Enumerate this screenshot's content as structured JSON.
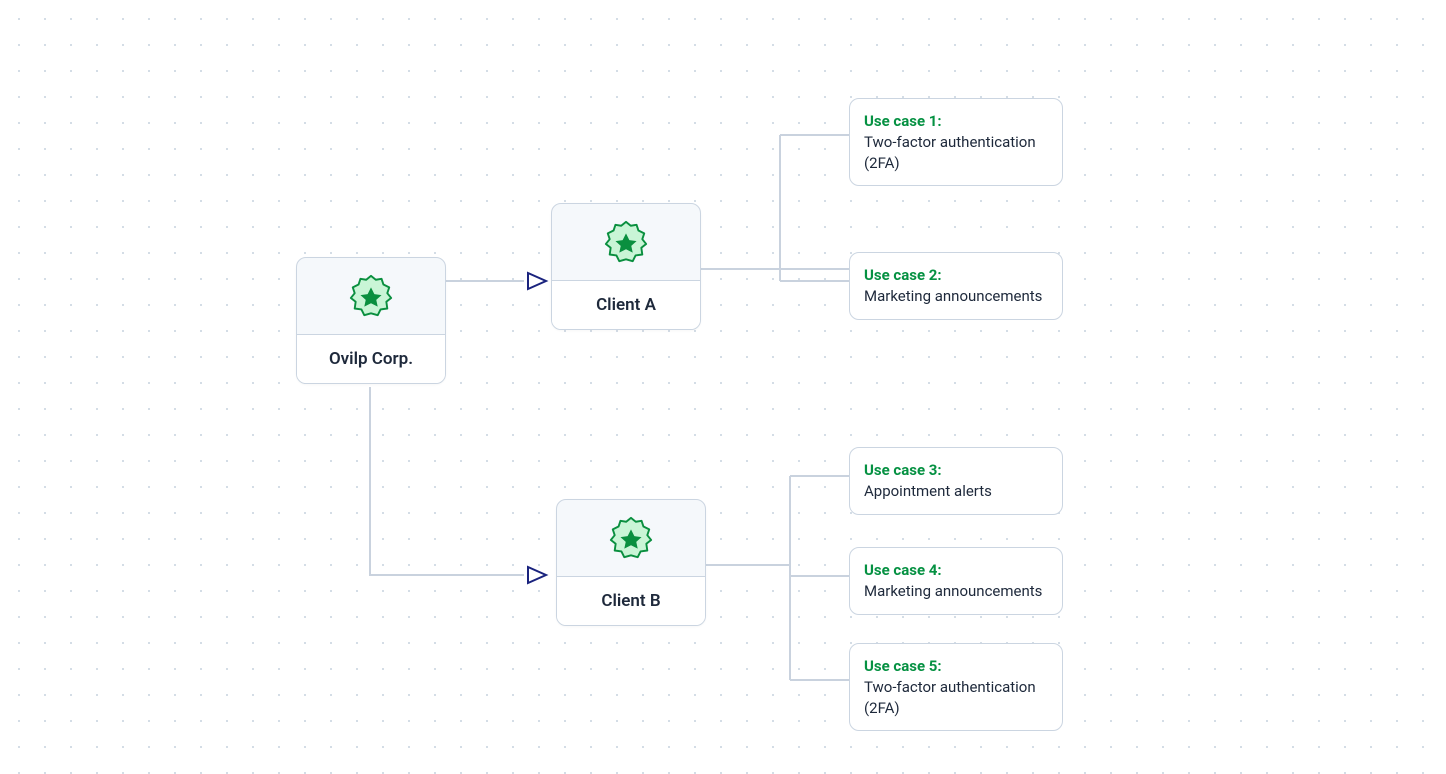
{
  "diagram": {
    "root": {
      "label": "Ovilp Corp."
    },
    "clients": [
      {
        "id": "client-a",
        "label": "Client A"
      },
      {
        "id": "client-b",
        "label": "Client B"
      }
    ],
    "usecases": [
      {
        "id": "uc1",
        "client": "client-a",
        "title": "Use case 1:",
        "desc": "Two-factor authentication (2FA)"
      },
      {
        "id": "uc2",
        "client": "client-a",
        "title": "Use case 2:",
        "desc": "Marketing announcements"
      },
      {
        "id": "uc3",
        "client": "client-b",
        "title": "Use case 3:",
        "desc": "Appointment alerts"
      },
      {
        "id": "uc4",
        "client": "client-b",
        "title": "Use case 4:",
        "desc": "Marketing announcements"
      },
      {
        "id": "uc5",
        "client": "client-b",
        "title": "Use case 5:",
        "desc": "Two-factor authentication (2FA)"
      }
    ],
    "colors": {
      "border": "#cbd5e1",
      "accent_green": "#0a8f3f",
      "connector": "#c9d2de",
      "arrow": "#1a237e"
    }
  }
}
